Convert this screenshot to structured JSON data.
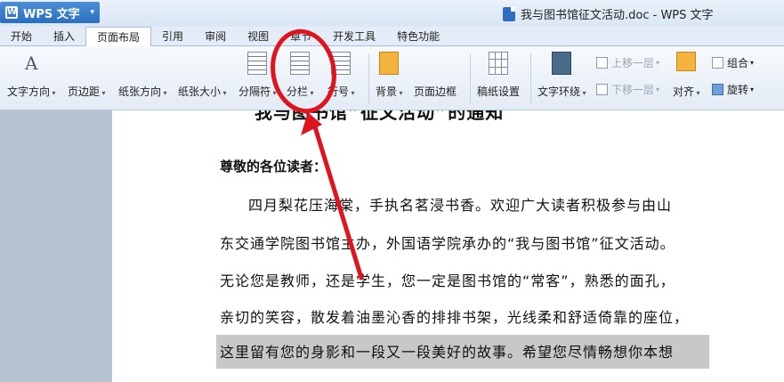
{
  "app": {
    "name": "WPS 文字"
  },
  "window": {
    "title": "我与图书馆征文活动.doc - WPS 文字"
  },
  "tabs": [
    "开始",
    "插入",
    "页面布局",
    "引用",
    "审阅",
    "视图",
    "章节",
    "开发工具",
    "特色功能"
  ],
  "active_tab": "页面布局",
  "ribbon": {
    "text_direction": "文字方向",
    "margins": "页边距",
    "orientation": "纸张方向",
    "size": "纸张大小",
    "breaks": "分隔符",
    "columns": "分栏",
    "line_numbers": "行号",
    "background": "背景",
    "page_border": "页面边框",
    "grid_settings": "稿纸设置",
    "text_wrap": "文字环绕",
    "bring_forward": "上移一层",
    "send_backward": "下移一层",
    "align": "对齐",
    "group": "组合",
    "rotate": "旋转"
  },
  "document": {
    "heading_partial": "我与图书馆”征文活动”的通知",
    "greeting": "尊敬的各位读者：",
    "lines": [
      "四月梨花压海棠，手执名茗浸书香。欢迎广大读者积极参与由山",
      "东交通学院图书馆主办，外国语学院承办的“我与图书馆”征文活动。",
      "无论您是教师，还是学生，您一定是图书馆的“常客”，熟悉的面孔，",
      "亲切的笑容，散发着油墨沁香的排排书架，光线柔和舒适倚靠的座位，",
      "这里留有您的身影和一段又一段美好的故事。希望您尽情畅想你本想"
    ]
  },
  "colors": {
    "annotation": "#e0141e",
    "app_button": "#2a6ebf"
  }
}
